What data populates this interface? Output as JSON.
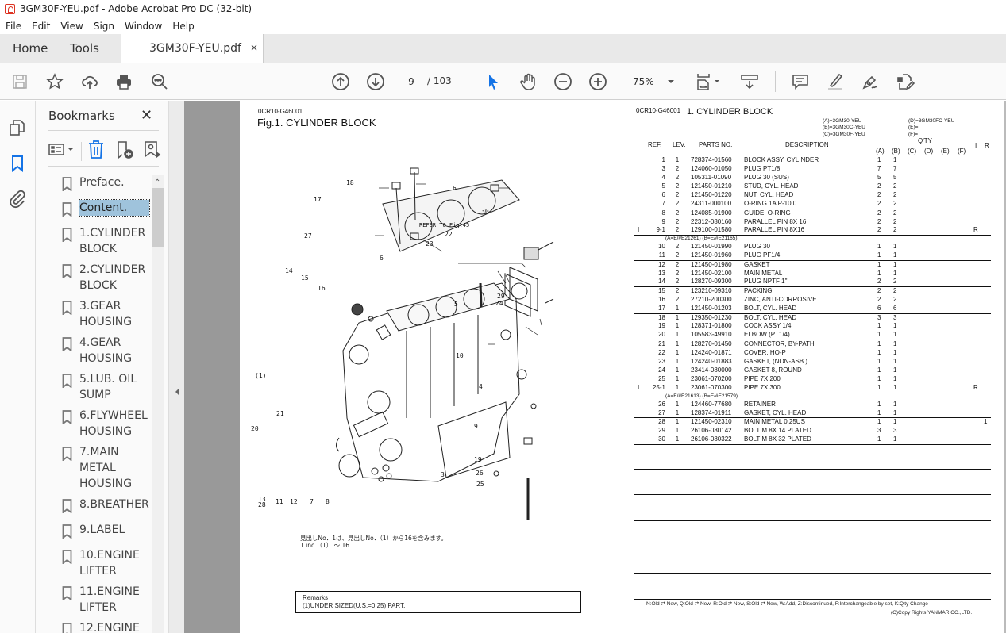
{
  "window": {
    "title": "3GM30F-YEU.pdf - Adobe Acrobat Pro DC (32-bit)"
  },
  "menu": [
    "File",
    "Edit",
    "View",
    "Sign",
    "Window",
    "Help"
  ],
  "tabs": {
    "home": "Home",
    "tools": "Tools",
    "document": "3GM30F-YEU.pdf",
    "close": "×"
  },
  "toolbar": {
    "current_page": "9",
    "total_pages": "/ 103",
    "zoom": "75%"
  },
  "bookmarks": {
    "title": "Bookmarks",
    "close": "✕",
    "items": [
      {
        "label": "Preface.",
        "selected": false
      },
      {
        "label": "Content.",
        "selected": true
      },
      {
        "label": "1.CYLINDER BLOCK"
      },
      {
        "label": "2.CYLINDER BLOCK"
      },
      {
        "label": "3.GEAR HOUSING"
      },
      {
        "label": "4.GEAR HOUSING"
      },
      {
        "label": "5.LUB. OIL SUMP"
      },
      {
        "label": "6.FLYWHEEL HOUSING"
      },
      {
        "label": "7.MAIN METAL HOUSING"
      },
      {
        "label": "8.BREATHER"
      },
      {
        "label": "9.LABEL"
      },
      {
        "label": "10.ENGINE LIFTER"
      },
      {
        "label": "11.ENGINE LIFTER"
      },
      {
        "label": "12.ENGINE"
      }
    ]
  },
  "page": {
    "left_code": "0CR10-G46001",
    "fig_title": "Fig.1.  CYLINDER BLOCK",
    "right_code": "0CR10-G46001",
    "right_title": "1.  CYLINDER BLOCK",
    "models": {
      "a": "(A)=3GM30-YEU",
      "b": "(B)=3GM30C-YEU",
      "c": "(C)=3GM30F-YEU",
      "d": "(D)=3GM30FC-YEU",
      "e": "(E)=",
      "f": "(F)="
    },
    "headers": {
      "ref": "REF.",
      "lev": "LEV.",
      "parts_no": "PARTS NO.",
      "description": "DESCRIPTION",
      "qty": "Q'TY",
      "a": "(A)",
      "b": "(B)",
      "c": "(C)",
      "d": "(D)",
      "e": "(E)",
      "f": "(F)",
      "i": "I",
      "r": "R"
    },
    "groups": [
      {
        "note": "",
        "rows": [
          {
            "i": "",
            "ref": "1",
            "lev": "1",
            "pn": "728374-01560",
            "desc": "BLOCK ASSY, CYLINDER",
            "a": "1",
            "b": "1",
            "r": "",
            "x": ""
          },
          {
            "i": "",
            "ref": "3",
            "lev": "2",
            "pn": "124060-01050",
            "desc": "PLUG PT1/8",
            "a": "7",
            "b": "7",
            "r": "",
            "x": ""
          },
          {
            "i": "",
            "ref": "4",
            "lev": "2",
            "pn": "105311-01090",
            "desc": "PLUG 30 (SUS)",
            "a": "5",
            "b": "5",
            "r": "",
            "x": ""
          }
        ]
      },
      {
        "note": "",
        "rows": [
          {
            "i": "",
            "ref": "5",
            "lev": "2",
            "pn": "121450-01210",
            "desc": "STUD, CYL. HEAD",
            "a": "2",
            "b": "2",
            "r": "",
            "x": ""
          },
          {
            "i": "",
            "ref": "6",
            "lev": "2",
            "pn": "121450-01220",
            "desc": "NUT, CYL. HEAD",
            "a": "2",
            "b": "2",
            "r": "",
            "x": ""
          },
          {
            "i": "",
            "ref": "7",
            "lev": "2",
            "pn": "24311-000100",
            "desc": "O-RING 1A P-10.0",
            "a": "2",
            "b": "2",
            "r": "",
            "x": ""
          }
        ]
      },
      {
        "note": "",
        "rows": [
          {
            "i": "",
            "ref": "8",
            "lev": "2",
            "pn": "124085-01900",
            "desc": "GUIDE, O-RING",
            "a": "2",
            "b": "2",
            "r": "",
            "x": ""
          },
          {
            "i": "",
            "ref": "9",
            "lev": "2",
            "pn": "22312-080160",
            "desc": "PARALLEL PIN 8X 16",
            "a": "2",
            "b": "2",
            "r": "",
            "x": ""
          },
          {
            "i": "I",
            "ref": "9-1",
            "lev": "2",
            "pn": "129100-01580",
            "desc": "PARALLEL PIN 8X16",
            "a": "2",
            "b": "2",
            "r": "R",
            "x": ""
          }
        ]
      },
      {
        "note": "(A=E/#E21261)       (B=E/#E21165)",
        "rows": [
          {
            "i": "",
            "ref": "10",
            "lev": "2",
            "pn": "121450-01990",
            "desc": "PLUG 30",
            "a": "1",
            "b": "1",
            "r": "",
            "x": ""
          },
          {
            "i": "",
            "ref": "11",
            "lev": "2",
            "pn": "121450-01960",
            "desc": "PLUG PF1/4",
            "a": "1",
            "b": "1",
            "r": "",
            "x": ""
          }
        ]
      },
      {
        "note": "",
        "rows": [
          {
            "i": "",
            "ref": "12",
            "lev": "2",
            "pn": "121450-01980",
            "desc": "GASKET",
            "a": "1",
            "b": "1",
            "r": "",
            "x": ""
          },
          {
            "i": "",
            "ref": "13",
            "lev": "2",
            "pn": "121450-02100",
            "desc": "MAIN METAL",
            "a": "1",
            "b": "1",
            "r": "",
            "x": ""
          },
          {
            "i": "",
            "ref": "14",
            "lev": "2",
            "pn": "128270-09300",
            "desc": "PLUG NPTF 1\"",
            "a": "2",
            "b": "2",
            "r": "",
            "x": ""
          }
        ]
      },
      {
        "note": "",
        "rows": [
          {
            "i": "",
            "ref": "15",
            "lev": "2",
            "pn": "123210-09310",
            "desc": "PACKING",
            "a": "2",
            "b": "2",
            "r": "",
            "x": ""
          },
          {
            "i": "",
            "ref": "16",
            "lev": "2",
            "pn": "27210-200300",
            "desc": "ZINC, ANTI-CORROSIVE",
            "a": "2",
            "b": "2",
            "r": "",
            "x": ""
          },
          {
            "i": "",
            "ref": "17",
            "lev": "1",
            "pn": "121450-01203",
            "desc": "BOLT, CYL. HEAD",
            "a": "6",
            "b": "6",
            "r": "",
            "x": ""
          }
        ]
      },
      {
        "note": "",
        "rows": [
          {
            "i": "",
            "ref": "18",
            "lev": "1",
            "pn": "129350-01230",
            "desc": "BOLT, CYL. HEAD",
            "a": "3",
            "b": "3",
            "r": "",
            "x": ""
          },
          {
            "i": "",
            "ref": "19",
            "lev": "1",
            "pn": "128371-01800",
            "desc": "COCK ASSY 1/4",
            "a": "1",
            "b": "1",
            "r": "",
            "x": ""
          },
          {
            "i": "",
            "ref": "20",
            "lev": "1",
            "pn": "105583-49910",
            "desc": "ELBOW (PT1/4)",
            "a": "1",
            "b": "1",
            "r": "",
            "x": ""
          }
        ]
      },
      {
        "note": "",
        "rows": [
          {
            "i": "",
            "ref": "21",
            "lev": "1",
            "pn": "128270-01450",
            "desc": "CONNECTOR, BY-PATH",
            "a": "1",
            "b": "1",
            "r": "",
            "x": ""
          },
          {
            "i": "",
            "ref": "22",
            "lev": "1",
            "pn": "124240-01871",
            "desc": "COVER, HO-P",
            "a": "1",
            "b": "1",
            "r": "",
            "x": ""
          },
          {
            "i": "",
            "ref": "23",
            "lev": "1",
            "pn": "124240-01883",
            "desc": "GASKET, (NON-ASB.)",
            "a": "1",
            "b": "1",
            "r": "",
            "x": ""
          }
        ]
      },
      {
        "note": "",
        "rows": [
          {
            "i": "",
            "ref": "24",
            "lev": "1",
            "pn": "23414-080000",
            "desc": "GASKET 8, ROUND",
            "a": "1",
            "b": "1",
            "r": "",
            "x": ""
          },
          {
            "i": "",
            "ref": "25",
            "lev": "1",
            "pn": "23061-070200",
            "desc": "PIPE  7X 200",
            "a": "1",
            "b": "1",
            "r": "",
            "x": ""
          },
          {
            "i": "I",
            "ref": "25-1",
            "lev": "1",
            "pn": "23061-070300",
            "desc": "PIPE  7X 300",
            "a": "1",
            "b": "1",
            "r": "R",
            "x": ""
          }
        ]
      },
      {
        "note": "(A=E/#E21613)       (B=E/#E21579)",
        "rows": [
          {
            "i": "",
            "ref": "26",
            "lev": "1",
            "pn": "124460-77680",
            "desc": "RETAINER",
            "a": "1",
            "b": "1",
            "r": "",
            "x": ""
          },
          {
            "i": "",
            "ref": "27",
            "lev": "1",
            "pn": "128374-01911",
            "desc": "GASKET, CYL. HEAD",
            "a": "1",
            "b": "1",
            "r": "",
            "x": ""
          }
        ]
      },
      {
        "note": "",
        "rows": [
          {
            "i": "",
            "ref": "28",
            "lev": "1",
            "pn": "121450-02310",
            "desc": "MAIN METAL 0.25US",
            "a": "1",
            "b": "1",
            "r": "",
            "x": "1"
          },
          {
            "i": "",
            "ref": "29",
            "lev": "1",
            "pn": "26106-080142",
            "desc": "BOLT M 8X 14 PLATED",
            "a": "3",
            "b": "3",
            "r": "",
            "x": ""
          },
          {
            "i": "",
            "ref": "30",
            "lev": "1",
            "pn": "26106-080322",
            "desc": "BOLT M 8X 32 PLATED",
            "a": "1",
            "b": "1",
            "r": "",
            "x": ""
          }
        ]
      }
    ],
    "callouts": [
      "17",
      "18",
      "6",
      "27",
      "6",
      "30",
      "REFER TO Fig.45",
      "22",
      "23",
      "14",
      "15",
      "16",
      "5",
      "29",
      "24",
      "10",
      "(1)",
      "4",
      "21",
      "9",
      "20",
      "19",
      "3",
      "26",
      "25",
      "13",
      "28",
      "11",
      "12",
      "7",
      "8"
    ],
    "jp_note": "見出しNo．1は、見出しNo．（1）から16を含みます。",
    "inc_note": "1 inc.（1） ～ 16",
    "remarks_title": "Remarks",
    "remarks_text": "(1)UNDER SIZED(U.S.=0.25) PART.",
    "legend": "N:Old ⇄ New, Q:Old ⇄ New, R:Old ⇄ New, S:Old ⇄ New, W:Add, Z:Discontinued, F:Interchangeable by set, K:Q'ty Change",
    "copyright": "(C)Copy Rights YANMAR CO.,LTD."
  },
  "colors": {
    "accent": "#1473e6",
    "selection": "#9fc3dc",
    "viewer_bg": "#999999"
  }
}
